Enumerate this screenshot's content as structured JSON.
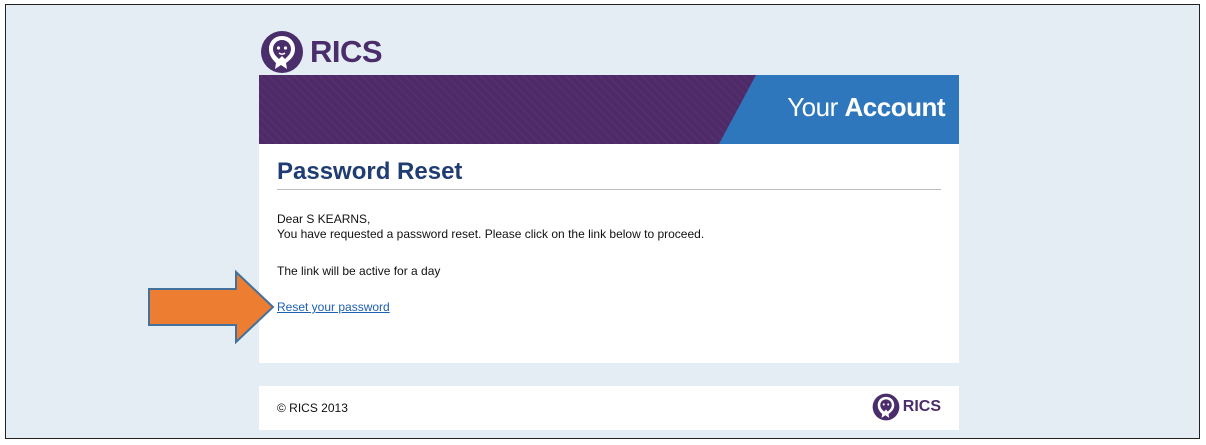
{
  "brand": {
    "name": "RICS",
    "color": "#4a2d6b"
  },
  "banner": {
    "title_regular": "Your",
    "title_bold": "Account",
    "purple": "#4f2a68",
    "blue": "#2f77bd"
  },
  "email": {
    "heading": "Password Reset",
    "greeting": "Dear S KEARNS,",
    "message": "You have requested a password reset. Please click on the link below to proceed.",
    "expiry_note": "The link will be active for a day",
    "reset_link": "Reset your password"
  },
  "footer": {
    "copyright": "© RICS 2013"
  },
  "annotation": {
    "arrow_icon": "orange-right-arrow",
    "arrow_color": "#ed7d31"
  }
}
